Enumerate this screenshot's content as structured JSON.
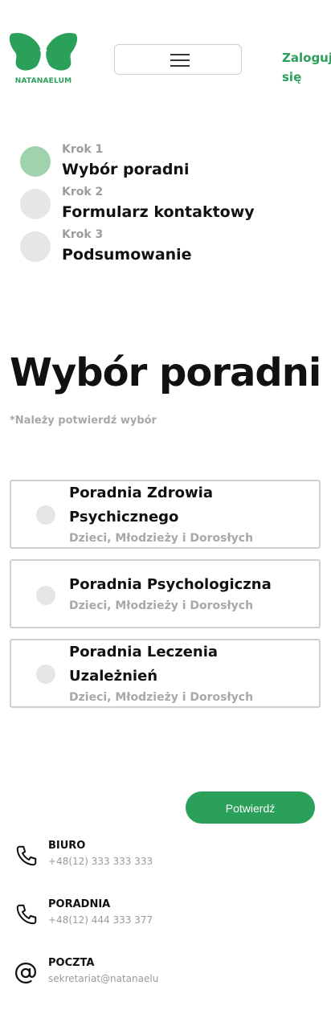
{
  "header": {
    "logo_text": "NATANAELUM",
    "login_label": "Zaloguj się"
  },
  "steps": [
    {
      "num": "Krok 1",
      "name": "Wybór poradni",
      "state": "active"
    },
    {
      "num": "Krok 2",
      "name": "Formularz kontaktowy",
      "state": "inactive"
    },
    {
      "num": "Krok 3",
      "name": "Podsumowanie",
      "state": "inactive"
    }
  ],
  "main": {
    "title": "Wybór poradni",
    "note": "*Należy potwierdź wybór",
    "options": [
      {
        "title": "Poradnia Zdrowia Psychicznego",
        "subtitle": "Dzieci, Młodzieży i Dorosłych"
      },
      {
        "title": "Poradnia Psychologiczna",
        "subtitle": "Dzieci, Młodzieży i Dorosłych"
      },
      {
        "title": "Poradnia Leczenia Uzależnień",
        "subtitle": "Dzieci, Młodzieży i Dorosłych"
      }
    ],
    "confirm_label": "Potwierdź"
  },
  "contact": [
    {
      "title": "BIURO",
      "value": "+48(12) 333 333 333",
      "icon": "phone-icon"
    },
    {
      "title": "PORADNIA",
      "value": "+48(12) 444 333 377",
      "icon": "phone-icon"
    },
    {
      "title": "POCZTA",
      "value": "sekretariat@natanaelu",
      "icon": "at-icon"
    }
  ],
  "colors": {
    "brand_green": "#2aa05a",
    "active_step": "#9fd3ae",
    "inactive_step": "#e6e6e6"
  }
}
